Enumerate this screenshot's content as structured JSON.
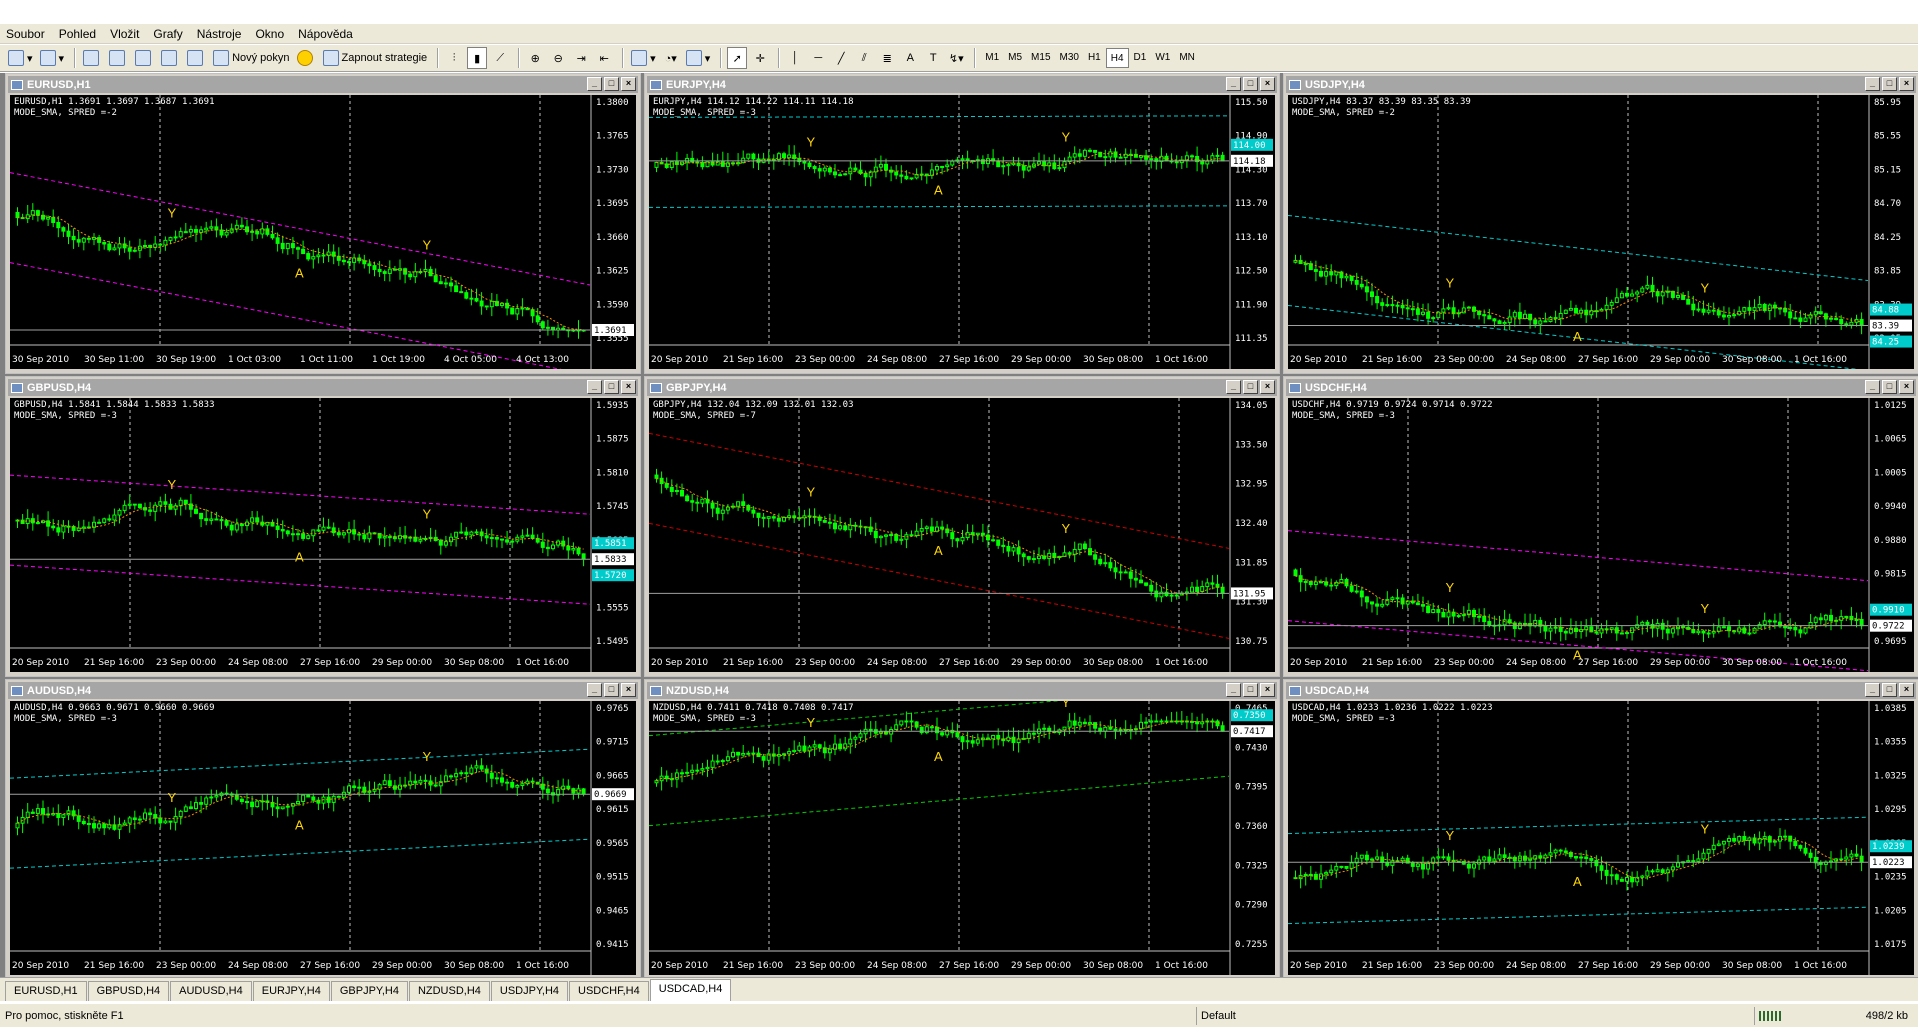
{
  "menu": [
    "Soubor",
    "Pohled",
    "Vložit",
    "Grafy",
    "Nástroje",
    "Okno",
    "Nápověda"
  ],
  "toolbar": {
    "new_order": "Nový pokyn",
    "strategies": "Zapnout strategie",
    "timeframes": [
      "M1",
      "M5",
      "M15",
      "M30",
      "H1",
      "H4",
      "D1",
      "W1",
      "MN"
    ],
    "active_timeframe": "H4"
  },
  "colors": {
    "chart_bg": "#000000",
    "candle": "#00ff00",
    "grid": "#c0c0c0",
    "fractal": "#ffd700",
    "sma": "#ff8c00",
    "channel_magenta": "#ff00ff",
    "channel_cyan": "#00cccc",
    "channel_green": "#00cc00",
    "channel_red": "#cc0000"
  },
  "charts": [
    {
      "title": "EURUSD,H1",
      "info": "EURUSD,H1  1.3691 1.3697 1.3687 1.3691",
      "mode": "MODE_SMA, SPRED =-2",
      "prices": [
        "1.3800",
        "1.3765",
        "1.3730",
        "1.3695",
        "1.3660",
        "1.3625",
        "1.3590",
        "1.3555"
      ],
      "current": "1.3691",
      "dates": [
        "30 Sep 2010",
        "30 Sep 11:00",
        "30 Sep 19:00",
        "1 Oct 03:00",
        "1 Oct 11:00",
        "1 Oct 19:00",
        "4 Oct 05:00",
        "4 Oct 13:00"
      ],
      "line_color": "#ff00ff"
    },
    {
      "title": "EURJPY,H4",
      "info": "EURJPY,H4  114.12 114.22 114.11 114.18",
      "mode": "MODE_SMA, SPRED =-3",
      "prices": [
        "115.50",
        "114.90",
        "114.30",
        "113.70",
        "113.10",
        "112.50",
        "111.90",
        "111.35"
      ],
      "current": "114.18",
      "extra_label": "114.00",
      "dates": [
        "20 Sep 2010",
        "21 Sep 16:00",
        "23 Sep 00:00",
        "24 Sep 08:00",
        "27 Sep 16:00",
        "29 Sep 00:00",
        "30 Sep 08:00",
        "1 Oct 16:00"
      ],
      "line_color": "#00cccc"
    },
    {
      "title": "USDJPY,H4",
      "info": "USDJPY,H4  83.37 83.39 83.35 83.39",
      "mode": "MODE_SMA, SPRED =-2",
      "prices": [
        "85.95",
        "85.55",
        "85.15",
        "84.70",
        "84.25",
        "83.85",
        "83.39",
        "83.05"
      ],
      "current": "83.39",
      "extra_label": "84.88",
      "extra_label2": "84.25",
      "dates": [
        "20 Sep 2010",
        "21 Sep 16:00",
        "23 Sep 00:00",
        "24 Sep 08:00",
        "27 Sep 16:00",
        "29 Sep 00:00",
        "30 Sep 08:00",
        "1 Oct 16:00"
      ],
      "line_color": "#00cccc"
    },
    {
      "title": "GBPUSD,H4",
      "info": "GBPUSD,H4  1.5841 1.5844 1.5833 1.5833",
      "mode": "MODE_SMA, SPRED =-3",
      "prices": [
        "1.5935",
        "1.5875",
        "1.5810",
        "1.5745",
        "1.5685",
        "1.5620",
        "1.5555",
        "1.5495"
      ],
      "current": "1.5833",
      "extra_label": "1.5851",
      "extra_label2": "1.5720",
      "dates": [
        "20 Sep 2010",
        "21 Sep 16:00",
        "23 Sep 00:00",
        "24 Sep 08:00",
        "27 Sep 16:00",
        "29 Sep 00:00",
        "30 Sep 08:00",
        "1 Oct 16:00"
      ],
      "line_color": "#ff00ff"
    },
    {
      "title": "GBPJPY,H4",
      "info": "GBPJPY,H4  132.04 132.09 132.01 132.03",
      "mode": "MODE_SMA, SPRED =-7",
      "prices": [
        "134.05",
        "133.50",
        "132.95",
        "132.40",
        "131.85",
        "131.30",
        "130.75"
      ],
      "current": "131.95",
      "dates": [
        "20 Sep 2010",
        "21 Sep 16:00",
        "23 Sep 00:00",
        "24 Sep 08:00",
        "27 Sep 16:00",
        "29 Sep 00:00",
        "30 Sep 08:00",
        "1 Oct 16:00"
      ],
      "line_color": "#cc0000"
    },
    {
      "title": "USDCHF,H4",
      "info": "USDCHF,H4  0.9719 0.9724 0.9714 0.9722",
      "mode": "MODE_SMA, SPRED =-3",
      "prices": [
        "1.0125",
        "1.0065",
        "1.0005",
        "0.9940",
        "0.9880",
        "0.9815",
        "0.9755",
        "0.9695"
      ],
      "current": "0.9722",
      "extra_label": "0.9910",
      "dates": [
        "20 Sep 2010",
        "21 Sep 16:00",
        "23 Sep 00:00",
        "24 Sep 08:00",
        "27 Sep 16:00",
        "29 Sep 00:00",
        "30 Sep 08:00",
        "1 Oct 16:00"
      ],
      "line_color": "#ff00ff"
    },
    {
      "title": "AUDUSD,H4",
      "info": "AUDUSD,H4  0.9663 0.9671 0.9660 0.9669",
      "mode": "MODE_SMA, SPRED =-3",
      "prices": [
        "0.9765",
        "0.9715",
        "0.9665",
        "0.9615",
        "0.9565",
        "0.9515",
        "0.9465",
        "0.9415"
      ],
      "current": "0.9669",
      "dates": [
        "20 Sep 2010",
        "21 Sep 16:00",
        "23 Sep 00:00",
        "24 Sep 08:00",
        "27 Sep 16:00",
        "29 Sep 00:00",
        "30 Sep 08:00",
        "1 Oct 16:00"
      ],
      "line_color": "#00cccc"
    },
    {
      "title": "NZDUSD,H4",
      "info": "NZDUSD,H4  0.7411 0.7418 0.7408 0.7417",
      "mode": "MODE_SMA, SPRED =-3",
      "prices": [
        "0.7465",
        "0.7430",
        "0.7395",
        "0.7360",
        "0.7325",
        "0.7290",
        "0.7255"
      ],
      "current": "0.7417",
      "extra_label": "0.7350",
      "dates": [
        "20 Sep 2010",
        "21 Sep 16:00",
        "23 Sep 00:00",
        "24 Sep 08:00",
        "27 Sep 16:00",
        "29 Sep 00:00",
        "30 Sep 08:00",
        "1 Oct 16:00"
      ],
      "line_color": "#00cc00"
    },
    {
      "title": "USDCAD,H4",
      "info": "USDCAD,H4  1.0233 1.0236 1.0222 1.0223",
      "mode": "MODE_SMA, SPRED =-3",
      "prices": [
        "1.0385",
        "1.0355",
        "1.0325",
        "1.0295",
        "1.0265",
        "1.0235",
        "1.0205",
        "1.0175"
      ],
      "current": "1.0223",
      "extra_label": "1.0239",
      "dates": [
        "20 Sep 2010",
        "21 Sep 16:00",
        "23 Sep 00:00",
        "24 Sep 08:00",
        "27 Sep 16:00",
        "29 Sep 00:00",
        "30 Sep 08:00",
        "1 Oct 16:00"
      ],
      "line_color": "#00cccc"
    }
  ],
  "tabs": [
    "EURUSD,H1",
    "GBPUSD,H4",
    "AUDUSD,H4",
    "EURJPY,H4",
    "GBPJPY,H4",
    "NZDUSD,H4",
    "USDJPY,H4",
    "USDCHF,H4",
    "USDCAD,H4"
  ],
  "active_tab": "USDCAD,H4",
  "status": {
    "help": "Pro pomoc, stiskněte F1",
    "profile": "Default",
    "traffic": "498/2 kb"
  }
}
